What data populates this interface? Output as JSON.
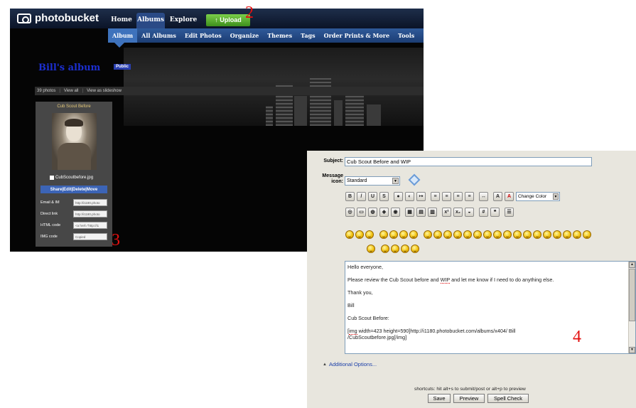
{
  "photobucket": {
    "logo": "photobucket",
    "top_tabs": [
      "Home",
      "Albums",
      "Explore"
    ],
    "upload_label": "Upload",
    "sub_tabs": [
      "Album",
      "All Albums",
      "Edit Photos",
      "Organize",
      "Themes",
      "Tags",
      "Order Prints & More",
      "Tools"
    ],
    "album_title": "Bill's album",
    "album_badge": "Public",
    "photo_count": "39 photos",
    "view_all": "View all",
    "view_slideshow": "View as slideshow",
    "photo": {
      "caption": "Cub Scout Before",
      "filename": "CubScoutbefore.jpg",
      "actions": "Share|Edit|Delete|Move",
      "links": [
        {
          "label": "Email & IM",
          "value": "http://i1180.photo"
        },
        {
          "label": "Direct link",
          "value": "http://i1180.photo"
        },
        {
          "label": "HTML code",
          "value": "<a href=\"http://i1"
        },
        {
          "label": "IMG code",
          "value": "Copied"
        }
      ]
    }
  },
  "editor": {
    "subject_label": "Subject:",
    "subject_value": "Cub Scout Before and WIP",
    "message_icon_label": "Message icon:",
    "message_icon_value": "Standard",
    "color_select": "Change Color",
    "message": {
      "line1": "Hello everyone,",
      "line2_pre": "Please review the Cub Scout before and ",
      "line2_wip": "WIP",
      "line2_post": " and let me know if I need to do anything else.",
      "line3": "Thank you,",
      "line4": "Bill",
      "line5": "Cub Scout Before:",
      "line6_img": "img",
      "line6_rest": " width=423 height=590]http://i1180.photobucket.com/albums/x404/ Bill",
      "line7": "/CubScoutbefore.jpg[/img]"
    },
    "additional_options": "Additional Options...",
    "shortcuts": "shortcuts: hit alt+s to submit/post or alt+p to preview",
    "save": "Save",
    "preview": "Preview",
    "spell_check": "Spell Check"
  },
  "annotations": {
    "two": "2",
    "three": "3",
    "four": "4",
    "color": "#e31010"
  }
}
